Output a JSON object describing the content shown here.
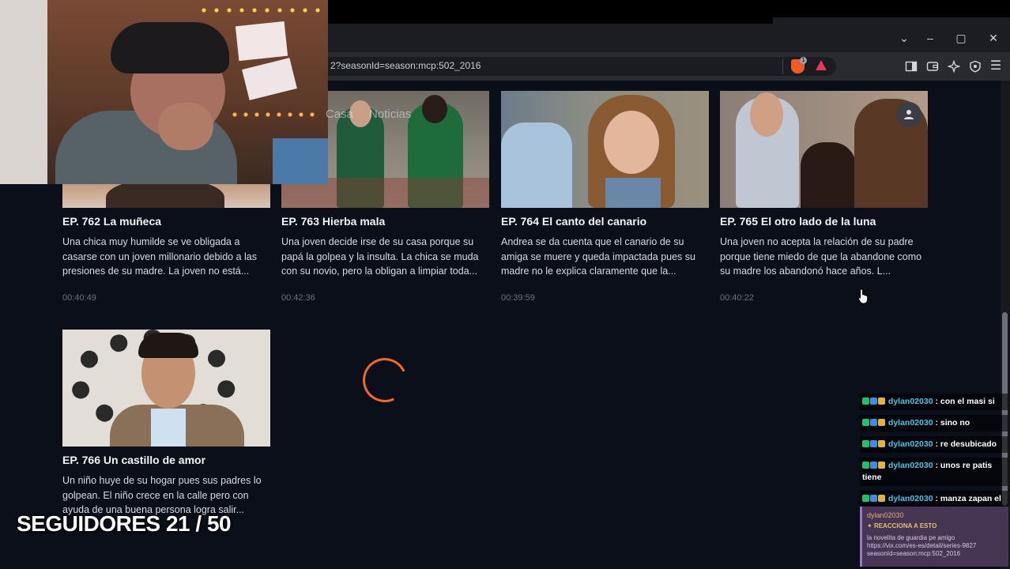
{
  "browser": {
    "url": "2?seasonId=season:mcp:502_2016",
    "brave_badge": "1",
    "window_controls": {
      "tabs": "⌄",
      "minimize": "–",
      "maximize": "▢",
      "close": "✕"
    }
  },
  "nav_overlay": [
    "Casa",
    "Noticias"
  ],
  "episodes": [
    {
      "title": "EP. 762  La muñeca",
      "description": "Una chica muy humilde se ve obligada a casarse con un joven millonario debido a las presiones de su madre. La joven no está...",
      "duration": "00:40:49"
    },
    {
      "title": "EP. 763  Hierba mala",
      "description": "Una joven decide irse de su casa porque su papá la golpea y la insulta. La chica se muda con su novio, pero la obligan a limpiar toda...",
      "duration": "00:42:36"
    },
    {
      "title": "EP. 764  El canto del canario",
      "description": "Andrea se da cuenta que el canario de su amiga se muere y queda impactada pues su madre no le explica claramente que la...",
      "duration": "00:39:59"
    },
    {
      "title": "EP. 765  El otro lado de la luna",
      "description": "Una joven no acepta la relación de su padre porque tiene miedo de que la abandone como su madre los abandonó hace años. L...",
      "duration": "00:40:22"
    },
    {
      "title": "EP. 766  Un castillo de amor",
      "description": "Un niño huye de su hogar pues sus padres lo golpean. El niño crece en la calle pero con ayuda de una buena persona logra salir...",
      "duration": ""
    }
  ],
  "stream": {
    "followers_text": "SEGUIDORES 21 / 50"
  },
  "chat": [
    {
      "user": "dylan02030",
      "text": ": con el masi si"
    },
    {
      "user": "dylan02030",
      "text": ": sino no"
    },
    {
      "user": "dylan02030",
      "text": ": re desubicado"
    },
    {
      "user": "dylan02030",
      "text": ": unos re patis tiene"
    },
    {
      "user": "dylan02030",
      "text": ": manza zapan el ariel"
    }
  ],
  "highlight": {
    "user": "dylan02030",
    "label": "REACCIONA A ESTO",
    "text": "la novelita de guardia pe amigo https://vix.com/es-es/detail/series-9827 seasonId=season:mcp:502_2016"
  },
  "colors": {
    "accent": "#f26b1d",
    "chat_user": "#3fc6e8",
    "background": "#0b0f19"
  }
}
